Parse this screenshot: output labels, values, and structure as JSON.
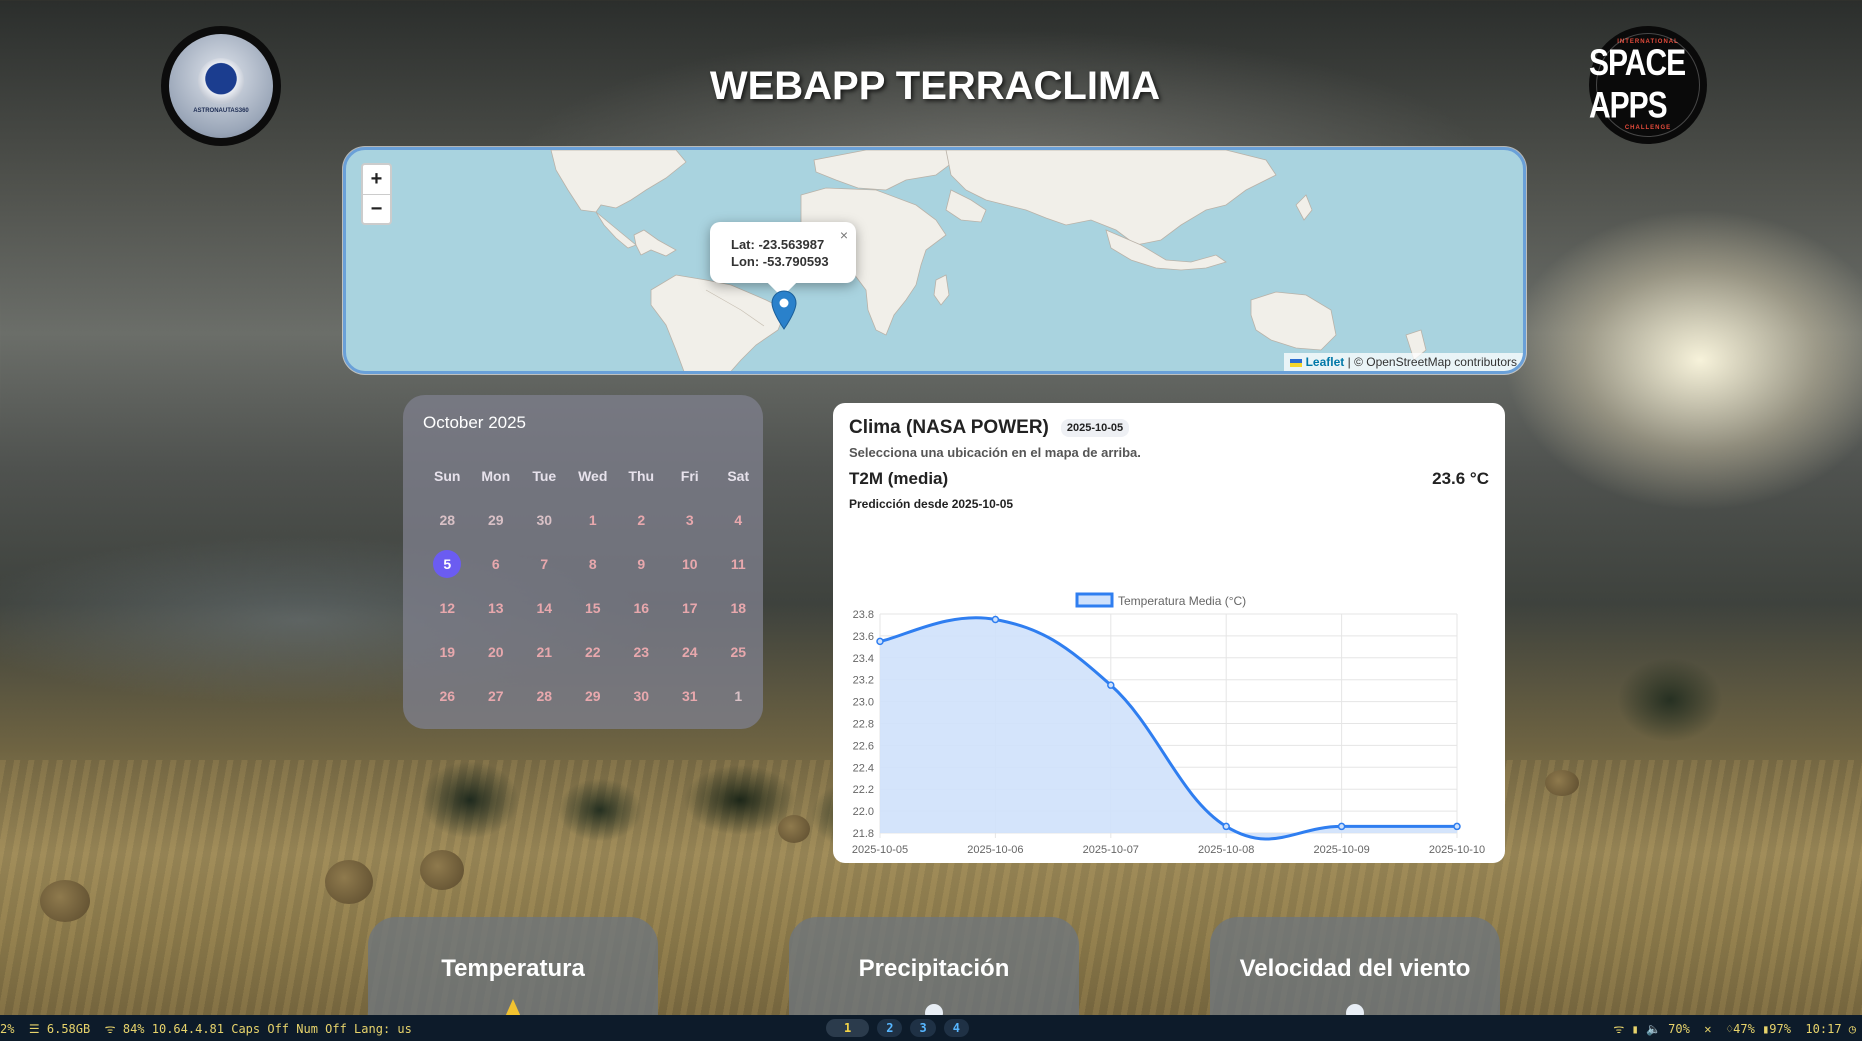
{
  "app": {
    "title": "WEBAPP TERRACLIMA"
  },
  "logos": {
    "left_text": "ASTRONAUTAS360",
    "right_top": "INTERNATIONAL",
    "right_main": "SPACE APPS",
    "right_bottom": "CHALLENGE"
  },
  "map": {
    "zoom_in": "+",
    "zoom_out": "−",
    "popup": {
      "lat": "Lat: -23.563987",
      "lon": "Lon: -53.790593",
      "close": "×"
    },
    "attribution": {
      "leaflet": "Leaflet",
      "rest": " | © OpenStreetMap contributors"
    }
  },
  "calendar": {
    "title": "October 2025",
    "weekdays": [
      "Sun",
      "Mon",
      "Tue",
      "Wed",
      "Thu",
      "Fri",
      "Sat"
    ],
    "weeks": [
      [
        "28",
        "29",
        "30",
        "1",
        "2",
        "3",
        "4"
      ],
      [
        "5",
        "6",
        "7",
        "8",
        "9",
        "10",
        "11"
      ],
      [
        "12",
        "13",
        "14",
        "15",
        "16",
        "17",
        "18"
      ],
      [
        "19",
        "20",
        "21",
        "22",
        "23",
        "24",
        "25"
      ],
      [
        "26",
        "27",
        "28",
        "29",
        "30",
        "31",
        "1"
      ]
    ],
    "selected": "5"
  },
  "climate": {
    "title": "Clima (NASA POWER)",
    "date_badge": "2025-10-05",
    "hint": "Selecciona una ubicación en el mapa de arriba.",
    "metric_label": "T2M (media)",
    "metric_value": "23.6 °C",
    "prediction": "Predicción desde 2025-10-05"
  },
  "chart_data": {
    "type": "area",
    "categories": [
      "2025-10-05",
      "2025-10-06",
      "2025-10-07",
      "2025-10-08",
      "2025-10-09",
      "2025-10-10"
    ],
    "series": [
      {
        "name": "Temperatura Media (°C)",
        "values": [
          23.55,
          23.75,
          23.15,
          21.86,
          21.86,
          21.86
        ]
      }
    ],
    "ylim": [
      21.8,
      23.8
    ],
    "yticks": [
      "23.8",
      "23.6",
      "23.4",
      "23.2",
      "23.0",
      "22.8",
      "22.6",
      "22.4",
      "22.2",
      "22.0",
      "21.8"
    ],
    "grid": true,
    "legend": "top",
    "colors": {
      "line": "#2f7ef0",
      "fill": "#cfe1fb"
    }
  },
  "cards": [
    {
      "label": "Temperatura",
      "icon": "thermometer-icon"
    },
    {
      "label": "Precipitación",
      "icon": "rain-icon"
    },
    {
      "label": "Velocidad del viento",
      "icon": "wind-icon"
    }
  ],
  "taskbar": {
    "left": "2%  ☰ 6.58GB  ᯤ 84% 10.64.4.81 Caps Off Num Off Lang: us",
    "workspaces": [
      "1",
      "2",
      "3",
      "4"
    ],
    "active_workspace": "1",
    "right": "ᯤ ▮ 🔈 70%  ✕  ♢47% ▮97%  10:17 ◷"
  }
}
